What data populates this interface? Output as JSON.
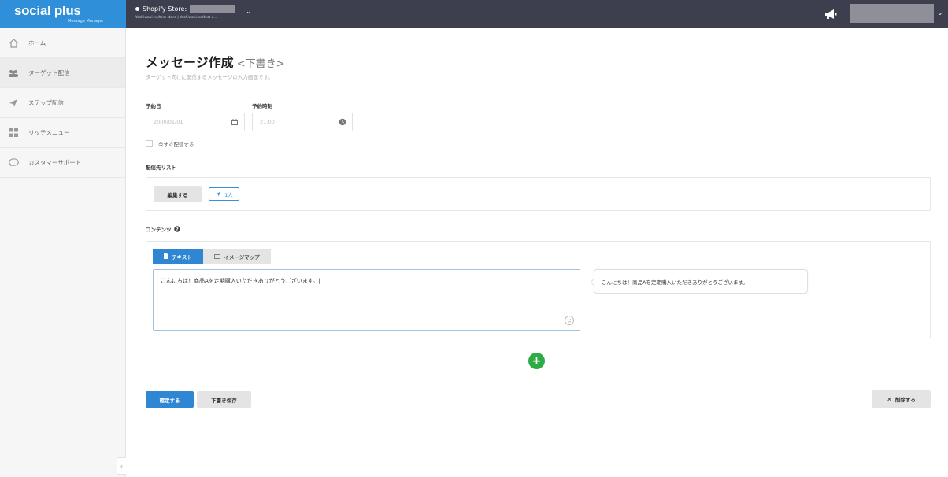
{
  "header": {
    "logo": "social plus",
    "logo_sub": "Message Manager",
    "store_label": "Shopify Store:",
    "store_sub": "Yoshiwaki.ne/test-store | Yoshiwaki.ne/test-s..."
  },
  "sidebar": {
    "items": [
      {
        "label": "ホーム",
        "icon": "home-icon"
      },
      {
        "label": "ターゲット配信",
        "icon": "users-icon"
      },
      {
        "label": "ステップ配信",
        "icon": "paper-plane-icon"
      },
      {
        "label": "リッチメニュー",
        "icon": "grid-icon"
      },
      {
        "label": "カスタマーサポート",
        "icon": "chat-bubble-icon"
      }
    ],
    "active_index": 1,
    "collapse_label": "‹"
  },
  "page": {
    "title": "メッセージ作成",
    "status": "<下書き>",
    "description": "ターゲット向けに配信するメッセージの入力画面です。"
  },
  "schedule": {
    "date_label": "予約日",
    "date_placeholder": "2000/01/01",
    "time_label": "予約時刻",
    "time_placeholder": "21:00",
    "send_now_label": "今すぐ配信する"
  },
  "recipients": {
    "label": "配信先リスト",
    "edit_button": "編集する",
    "count_tag": "1人"
  },
  "content": {
    "label": "コンテンツ",
    "tabs": [
      "テキスト",
      "イメージマップ"
    ],
    "active_tab": 0,
    "message_text": "こんにちは！商品Aを定期購入いただきありがとうございます。|",
    "preview_text": "こんにちは！商品Aを定期購入いただきありがとうございます。",
    "add_label": "+"
  },
  "actions": {
    "confirm": "確定する",
    "save_draft": "下書き保存",
    "delete": "削除する"
  },
  "colors": {
    "topbar": "#3d3f4f",
    "brand": "#2f8fd8",
    "primary": "#2f86d3",
    "add": "#2dab45"
  }
}
